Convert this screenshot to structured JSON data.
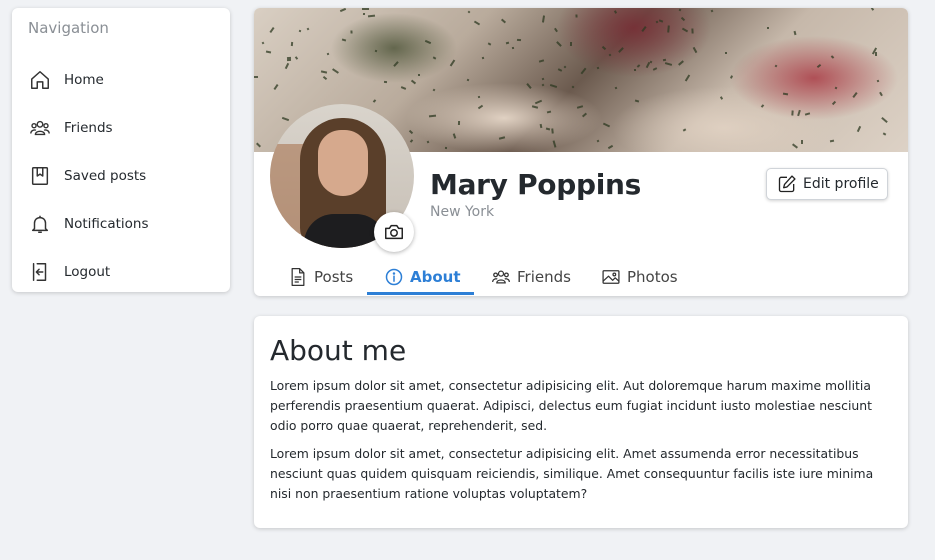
{
  "sidebar": {
    "heading": "Navigation",
    "items": [
      {
        "label": "Home",
        "icon": "home-icon"
      },
      {
        "label": "Friends",
        "icon": "people-icon"
      },
      {
        "label": "Saved posts",
        "icon": "bookmark-icon"
      },
      {
        "label": "Notifications",
        "icon": "bell-icon"
      },
      {
        "label": "Logout",
        "icon": "logout-icon"
      }
    ]
  },
  "profile": {
    "name": "Mary Poppins",
    "location": "New York",
    "edit_label": "Edit profile",
    "tabs": [
      {
        "label": "Posts",
        "icon": "document-icon",
        "active": false
      },
      {
        "label": "About",
        "icon": "info-icon",
        "active": true
      },
      {
        "label": "Friends",
        "icon": "people-icon",
        "active": false
      },
      {
        "label": "Photos",
        "icon": "image-icon",
        "active": false
      }
    ]
  },
  "about": {
    "title": "About me",
    "paragraphs": [
      "Lorem ipsum dolor sit amet, consectetur adipisicing elit. Aut doloremque harum maxime mollitia perferendis praesentium quaerat. Adipisci, delectus eum fugiat incidunt iusto molestiae nesciunt odio porro quae quaerat, reprehenderit, sed.",
      "Lorem ipsum dolor sit amet, consectetur adipisicing elit. Amet assumenda error necessitatibus nesciunt quas quidem quisquam reiciendis, similique. Amet consequuntur facilis iste iure minima nisi non praesentium ratione voluptas voluptatem?"
    ]
  },
  "colors": {
    "accent": "#2d7fd6",
    "background": "#f0f2f5",
    "muted_text": "#8a8f95"
  }
}
